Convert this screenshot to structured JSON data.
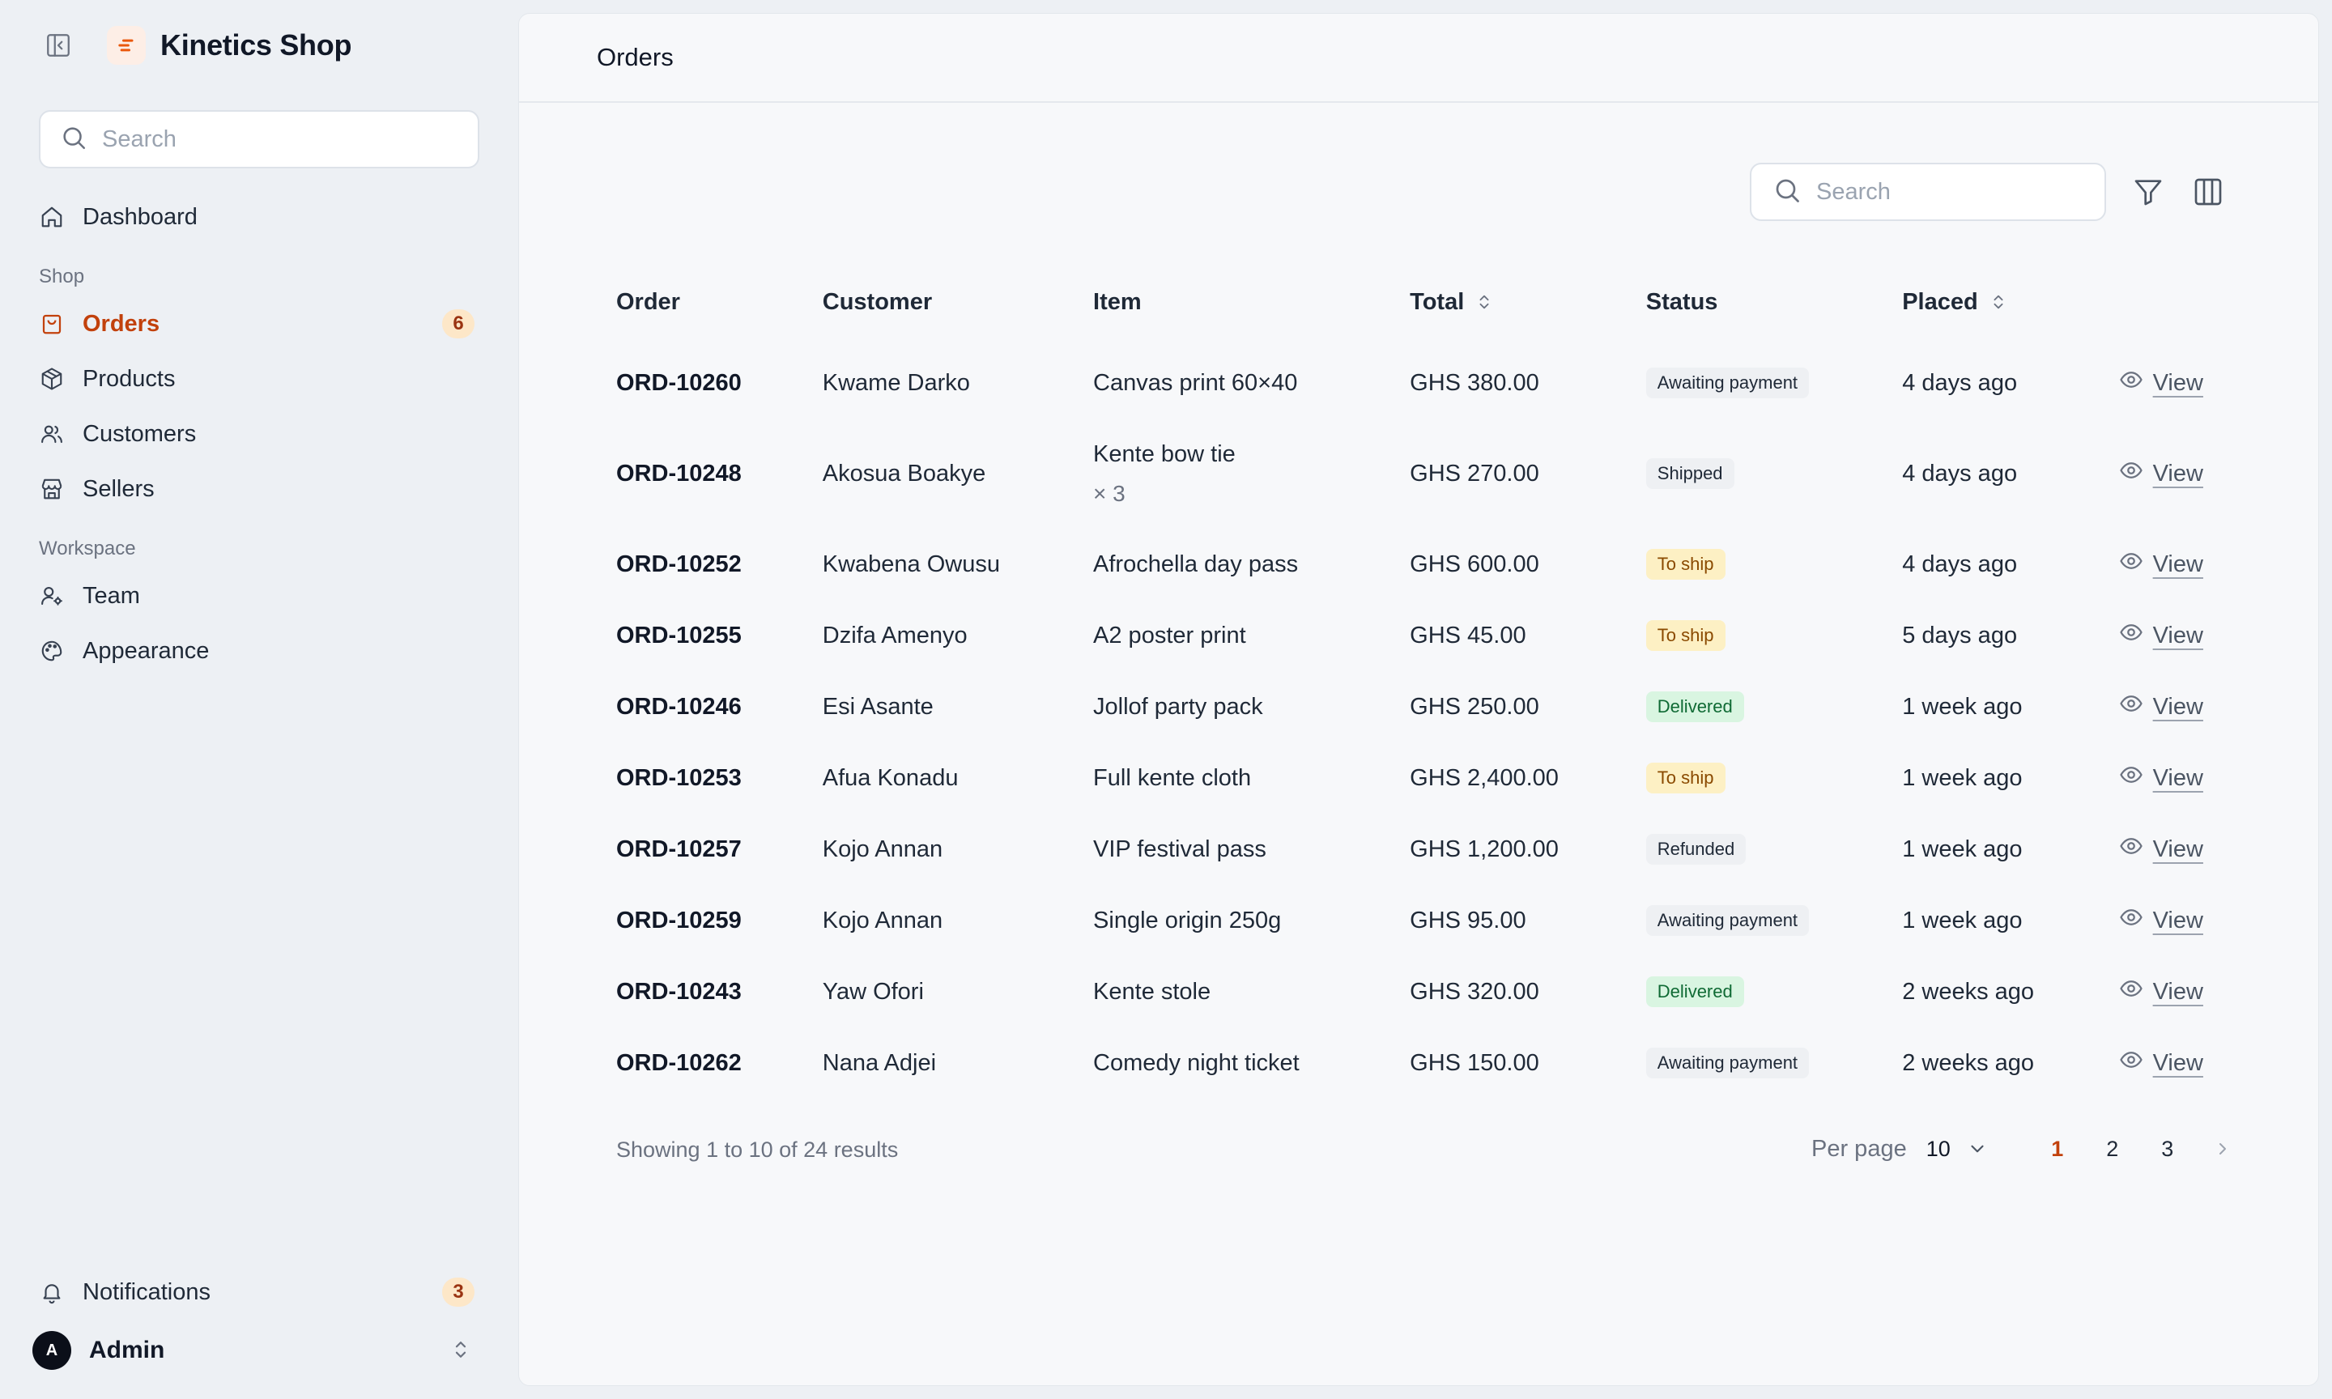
{
  "app": {
    "name": "Kinetics Shop"
  },
  "sidebar": {
    "search_placeholder": "Search",
    "dashboard_label": "Dashboard",
    "section_shop": "Shop",
    "orders_label": "Orders",
    "orders_count": "6",
    "products_label": "Products",
    "customers_label": "Customers",
    "sellers_label": "Sellers",
    "section_workspace": "Workspace",
    "team_label": "Team",
    "appearance_label": "Appearance",
    "notifications_label": "Notifications",
    "notifications_count": "3",
    "user_initial": "A",
    "user_name": "Admin"
  },
  "page": {
    "title": "Orders"
  },
  "toolbar": {
    "search_placeholder": "Search"
  },
  "table": {
    "headers": {
      "order": "Order",
      "customer": "Customer",
      "item": "Item",
      "total": "Total",
      "status": "Status",
      "placed": "Placed"
    },
    "view_label": "View",
    "rows": [
      {
        "id": "ORD-10260",
        "customer": "Kwame Darko",
        "item": "Canvas print 60×40",
        "qty": "",
        "total": "GHS 380.00",
        "status": "Awaiting payment",
        "status_kind": "awaiting",
        "placed": "4 days ago"
      },
      {
        "id": "ORD-10248",
        "customer": "Akosua Boakye",
        "item": "Kente bow tie",
        "qty": "× 3",
        "total": "GHS 270.00",
        "status": "Shipped",
        "status_kind": "shipped",
        "placed": "4 days ago"
      },
      {
        "id": "ORD-10252",
        "customer": "Kwabena Owusu",
        "item": "Afrochella day pass",
        "qty": "",
        "total": "GHS 600.00",
        "status": "To ship",
        "status_kind": "toship",
        "placed": "4 days ago"
      },
      {
        "id": "ORD-10255",
        "customer": "Dzifa Amenyo",
        "item": "A2 poster print",
        "qty": "",
        "total": "GHS 45.00",
        "status": "To ship",
        "status_kind": "toship",
        "placed": "5 days ago"
      },
      {
        "id": "ORD-10246",
        "customer": "Esi Asante",
        "item": "Jollof party pack",
        "qty": "",
        "total": "GHS 250.00",
        "status": "Delivered",
        "status_kind": "delivered",
        "placed": "1 week ago"
      },
      {
        "id": "ORD-10253",
        "customer": "Afua Konadu",
        "item": "Full kente cloth",
        "qty": "",
        "total": "GHS 2,400.00",
        "status": "To ship",
        "status_kind": "toship",
        "placed": "1 week ago"
      },
      {
        "id": "ORD-10257",
        "customer": "Kojo Annan",
        "item": "VIP festival pass",
        "qty": "",
        "total": "GHS 1,200.00",
        "status": "Refunded",
        "status_kind": "refunded",
        "placed": "1 week ago"
      },
      {
        "id": "ORD-10259",
        "customer": "Kojo Annan",
        "item": "Single origin 250g",
        "qty": "",
        "total": "GHS 95.00",
        "status": "Awaiting payment",
        "status_kind": "awaiting",
        "placed": "1 week ago"
      },
      {
        "id": "ORD-10243",
        "customer": "Yaw Ofori",
        "item": "Kente stole",
        "qty": "",
        "total": "GHS 320.00",
        "status": "Delivered",
        "status_kind": "delivered",
        "placed": "2 weeks ago"
      },
      {
        "id": "ORD-10262",
        "customer": "Nana Adjei",
        "item": "Comedy night ticket",
        "qty": "",
        "total": "GHS 150.00",
        "status": "Awaiting payment",
        "status_kind": "awaiting",
        "placed": "2 weeks ago"
      }
    ]
  },
  "footer": {
    "results_text": "Showing 1 to 10 of 24 results",
    "per_page_label": "Per page",
    "per_page_value": "10",
    "pages": [
      "1",
      "2",
      "3"
    ],
    "current_page": "1"
  },
  "colors": {
    "accent": "#c2410c",
    "badge_bg": "#fde7c8",
    "to_ship_bg": "#fdf0c4",
    "delivered_bg": "#d9f5e1",
    "neutral_badge_bg": "#eef0f3"
  },
  "icons": {
    "collapse": "sidebar-collapse-icon",
    "logo": "brand-logo-icon",
    "search": "search-icon",
    "dashboard": "home-icon",
    "orders": "shopping-bag-icon",
    "products": "box-icon",
    "customers": "users-icon",
    "sellers": "store-icon",
    "team": "user-gear-icon",
    "appearance": "palette-icon",
    "notifications": "bell-icon",
    "filter": "filter-icon",
    "columns": "columns-icon",
    "view": "eye-icon",
    "sort": "sort-arrows-icon",
    "next": "chevron-right-icon"
  }
}
